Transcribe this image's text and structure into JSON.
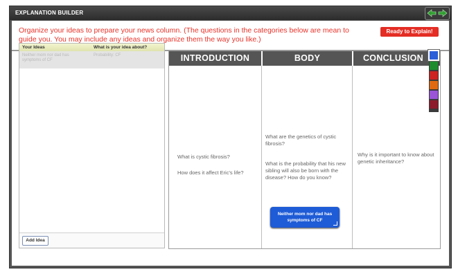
{
  "window": {
    "title": "EXPLANATION BUILDER",
    "nav_back_icon": "arrow-left-icon",
    "nav_forward_icon": "arrow-right-icon",
    "nav_color": "#2e9e2e"
  },
  "header": {
    "instructions": "Organize your ideas to prepare your news column. (The questions in the categories below are mean to guide you. You may include any ideas and organize them the way you like.)",
    "ready_button": "Ready to Explain!",
    "accent_color": "#e42d24"
  },
  "ideas": {
    "columns": [
      "Your Ideas",
      "What is your idea about?"
    ],
    "rows": [
      {
        "idea": "Neither mom nor dad has symptoms of CF",
        "about": "Probability: CF"
      }
    ],
    "add_button": "Add Idea"
  },
  "board": {
    "columns": [
      {
        "title": "INTRODUCTION",
        "questions": [
          "What is cystic fibrosis?",
          "How does it affect Eric's life?"
        ]
      },
      {
        "title": "BODY",
        "questions": [
          "What are the genetics of cystic fibrosis?",
          "What is the probability that his new sibling will also be born with the disease? How do you know?"
        ]
      },
      {
        "title": "CONCLUSION",
        "questions": [
          "Why is it important to know about genetic inheritance?"
        ]
      }
    ],
    "note": {
      "text": "Neither mom nor dad has symptoms of CF",
      "color": "#1e5bd6"
    }
  },
  "palette": [
    {
      "name": "blue",
      "color": "#2a5fd8",
      "selected": true
    },
    {
      "name": "green",
      "color": "#1e8c2e"
    },
    {
      "name": "red",
      "color": "#cc2222"
    },
    {
      "name": "orange",
      "color": "#e06a12"
    },
    {
      "name": "purple",
      "color": "#9a55d6"
    },
    {
      "name": "maroon",
      "color": "#8c1c2c"
    }
  ]
}
